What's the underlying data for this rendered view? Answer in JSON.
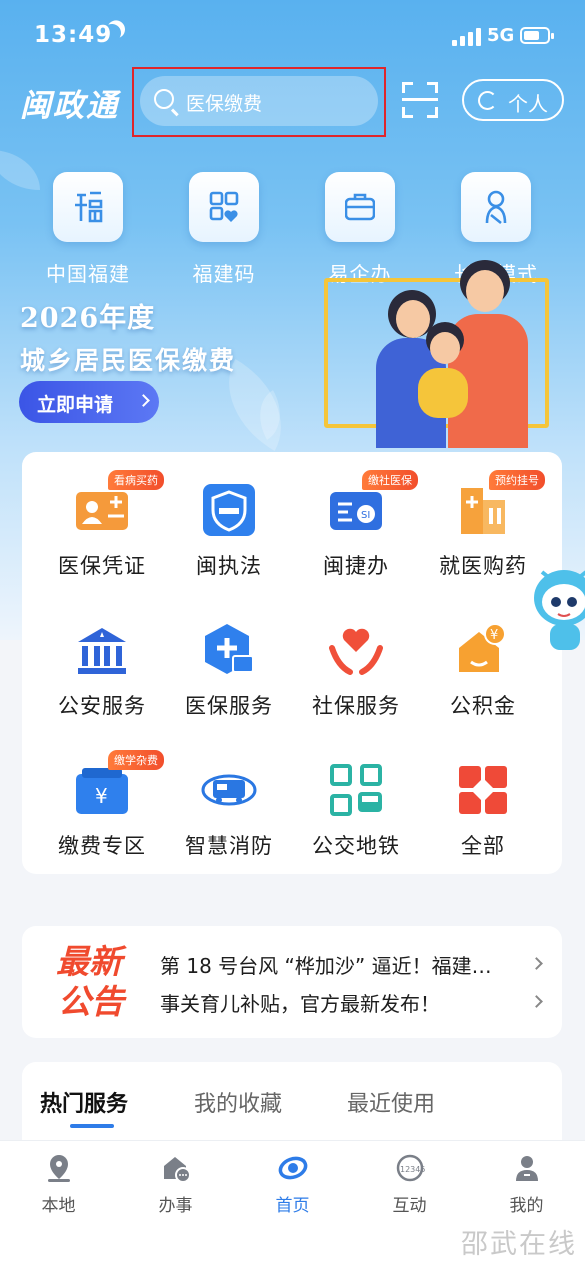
{
  "status_bar": {
    "time": "13:49",
    "network": "5G",
    "battery_level": 0.7
  },
  "header": {
    "logo": "闽政通",
    "search_placeholder": "医保缴费",
    "personal_label": "个人"
  },
  "quick_links": [
    {
      "label": "中国福建",
      "icon": "fu-character-icon"
    },
    {
      "label": "福建码",
      "icon": "qr-heart-icon"
    },
    {
      "label": "易企办",
      "icon": "briefcase-icon"
    },
    {
      "label": "长者模式",
      "icon": "elder-icon"
    }
  ],
  "banner": {
    "title_line1": "2026年度",
    "title_line2": "城乡居民医保缴费",
    "button": "立即申请"
  },
  "services": [
    {
      "label": "医保凭证",
      "badge": "看病买药",
      "icon": "medical-card-icon",
      "color": "#f59a3b"
    },
    {
      "label": "闽执法",
      "badge": "",
      "icon": "law-badge-icon",
      "color": "#2f80ed"
    },
    {
      "label": "闽捷办",
      "badge": "缴社医保",
      "icon": "social-card-icon",
      "color": "#2f6fe0"
    },
    {
      "label": "就医购药",
      "badge": "预约挂号",
      "icon": "hospital-icon",
      "color": "#f6a23c"
    },
    {
      "label": "公安服务",
      "badge": "",
      "icon": "police-building-icon",
      "color": "#2f64d8"
    },
    {
      "label": "医保服务",
      "badge": "",
      "icon": "medical-shield-icon",
      "color": "#2f80ed"
    },
    {
      "label": "社保服务",
      "badge": "",
      "icon": "heart-hands-icon",
      "color": "#f0503a"
    },
    {
      "label": "公积金",
      "badge": "",
      "icon": "fund-coin-icon",
      "color": "#f7a131"
    },
    {
      "label": "缴费专区",
      "badge": "缴学杂费",
      "icon": "wallet-yuan-icon",
      "color": "#2f80ed"
    },
    {
      "label": "智慧消防",
      "badge": "",
      "icon": "fire-truck-icon",
      "color": "#2a77e2"
    },
    {
      "label": "公交地铁",
      "badge": "",
      "icon": "bus-qr-icon",
      "color": "#2bb3a4"
    },
    {
      "label": "全部",
      "badge": "",
      "icon": "all-grid-icon",
      "color": "#ef4a38"
    }
  ],
  "notices": {
    "tag_line1": "最新",
    "tag_line2": "公告",
    "items": [
      "第 18 号台风 “桦加沙” 逼近！福建…",
      "事关育儿补贴，官方最新发布！"
    ]
  },
  "tabs": [
    "热门服务",
    "我的收藏",
    "最近使用"
  ],
  "nav": [
    {
      "label": "本地",
      "icon": "location-pin-icon"
    },
    {
      "label": "办事",
      "icon": "house-chat-icon"
    },
    {
      "label": "首页",
      "icon": "home-swirl-icon"
    },
    {
      "label": "互动",
      "icon": "hotline-12345-icon"
    },
    {
      "label": "我的",
      "icon": "profile-icon"
    }
  ],
  "watermark": "邵武在线",
  "colors": {
    "accent": "#2e7ce8",
    "hero_top": "#59b1ef",
    "highlight_box": "#e0252b",
    "apply_button": "#3b55e6"
  }
}
